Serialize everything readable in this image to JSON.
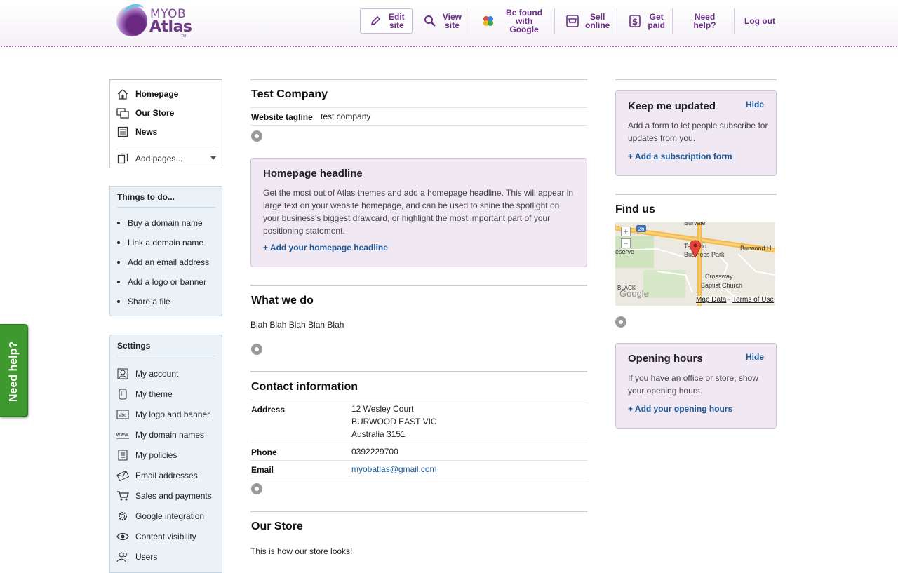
{
  "header": {
    "logo_top": "MYOB",
    "logo_bottom": "Atlas",
    "logo_tm": "TM",
    "nav": [
      {
        "line1": "Edit",
        "line2": "site",
        "icon": "pencil-icon"
      },
      {
        "line1": "View",
        "line2": "site",
        "icon": "magnifier-icon"
      },
      {
        "line1": "Be found",
        "line2": "with Google",
        "icon": "google-icon"
      },
      {
        "line1": "Sell",
        "line2": "online",
        "icon": "cart-icon"
      },
      {
        "line1": "Get",
        "line2": "paid",
        "icon": "dollar-icon"
      }
    ],
    "need_help": "Need help?",
    "logout": "Log out"
  },
  "sidebar": {
    "pages": [
      {
        "label": "Homepage",
        "icon": "home-icon"
      },
      {
        "label": "Our Store",
        "icon": "store-icon"
      },
      {
        "label": "News",
        "icon": "news-icon"
      }
    ],
    "add_pages": "Add pages...",
    "todo_title": "Things to do...",
    "todo": [
      "Buy a domain name",
      "Link a domain name",
      "Add an email address",
      "Add a logo or banner",
      "Share a file"
    ],
    "settings_title": "Settings",
    "settings": [
      {
        "label": "My account",
        "icon": "account-icon"
      },
      {
        "label": "My theme",
        "icon": "theme-icon"
      },
      {
        "label": "My logo and banner",
        "icon": "logo-banner-icon"
      },
      {
        "label": "My domain names",
        "icon": "www-icon"
      },
      {
        "label": "My policies",
        "icon": "policies-icon"
      },
      {
        "label": "Email addresses",
        "icon": "envelope-icon"
      },
      {
        "label": "Sales and payments",
        "icon": "cart-icon"
      },
      {
        "label": "Google integration",
        "icon": "gear-icon"
      },
      {
        "label": "Content visibility",
        "icon": "eye-icon"
      },
      {
        "label": "Users",
        "icon": "users-icon"
      }
    ],
    "help_tab": "Need help?"
  },
  "main": {
    "company": "Test Company",
    "tagline_label": "Website tagline",
    "tagline_value": "test company",
    "headline_box": {
      "title": "Homepage headline",
      "desc": "Get the most out of Atlas themes and add a homepage headline. This will appear in large text on your website homepage, and can be used to shine the spotlight on your business's biggest drawcard, or highlight the most important part of your positioning statement.",
      "action": "+ Add your homepage headline"
    },
    "what_title": "What we do",
    "what_text": "Blah Blah Blah Blah Blah",
    "contact_title": "Contact information",
    "address_label": "Address",
    "address_lines": [
      "12 Wesley Court",
      "BURWOOD EAST VIC",
      "Australia 3151"
    ],
    "phone_label": "Phone",
    "phone_value": "0392229700",
    "email_label": "Email",
    "email_value": "myobatlas@gmail.com",
    "store_title": "Our Store",
    "store_text": "This is how our store looks!"
  },
  "right": {
    "keep_updated": {
      "title": "Keep me updated",
      "hide": "Hide",
      "desc": "Add a form to let people subscribe for updates from you.",
      "action": "+ Add a subscription form"
    },
    "find_us_title": "Find us",
    "map": {
      "labels": [
        "Burvale",
        "Burwood H",
        "Tally Ho",
        "Business Park",
        "Crossway",
        "Baptist Church",
        "eserve",
        "BLACK",
        "26"
      ],
      "data_link": "Map Data",
      "terms_link": "Terms of Use",
      "zoom_in": "+",
      "zoom_out": "−",
      "google": "Google"
    },
    "opening_hours": {
      "title": "Opening hours",
      "hide": "Hide",
      "desc": "If you have an office or store, show your opening hours.",
      "action": "+ Add your opening hours"
    }
  },
  "colors": {
    "brand_purple": "#6a2f86",
    "link_blue": "#1d5a99",
    "panel_blue": "#eaf2f8",
    "promo_lilac": "#f0e9f4",
    "help_green": "#3e9a2f"
  }
}
